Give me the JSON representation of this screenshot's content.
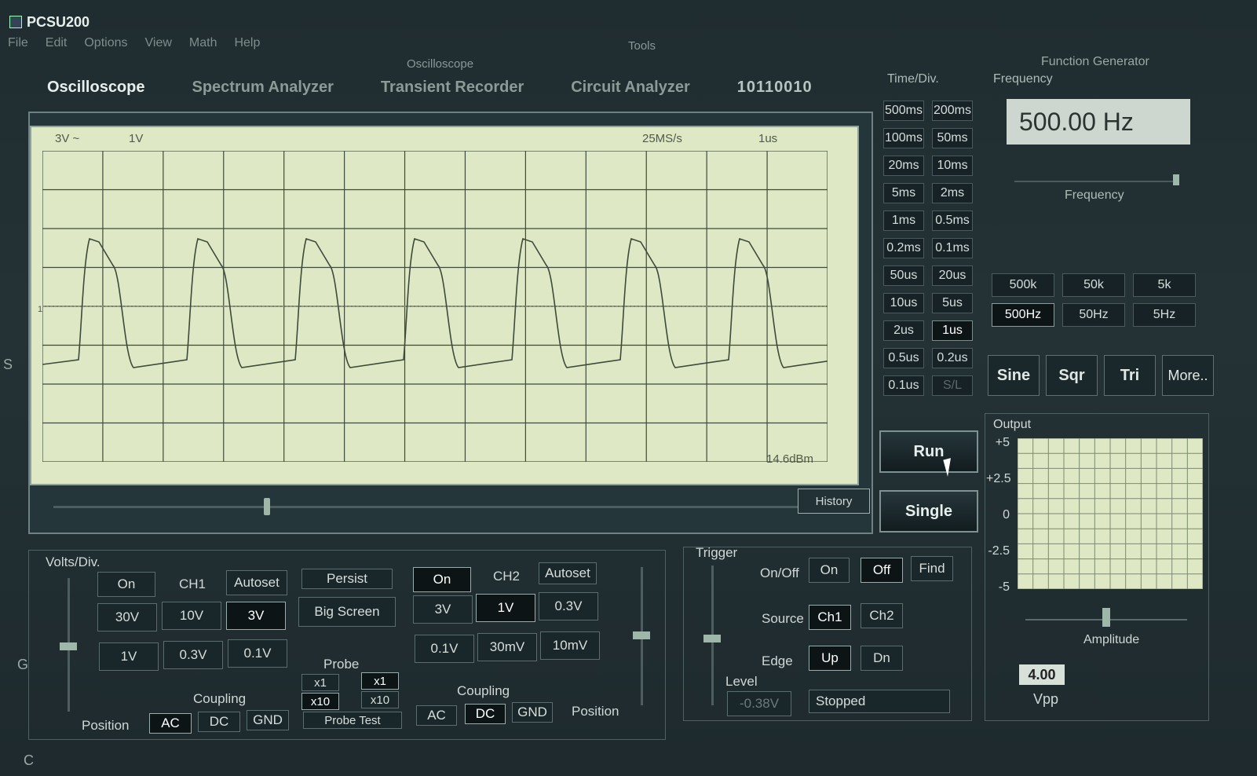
{
  "app": {
    "title": "PCSU200"
  },
  "menu": [
    "File",
    "Edit",
    "Options",
    "View",
    "Math",
    "Help"
  ],
  "labels": {
    "tools": "Tools",
    "oscilloscope_group": "Oscilloscope",
    "function_generator": "Function Generator"
  },
  "tabs": [
    {
      "label": "Oscilloscope",
      "active": true
    },
    {
      "label": "Spectrum Analyzer",
      "active": false
    },
    {
      "label": "Transient Recorder",
      "active": false
    },
    {
      "label": "Circuit Analyzer",
      "active": false
    }
  ],
  "binary_readout": "10110010",
  "screen": {
    "ch1_scale": "3V ~",
    "ch2_scale": "1V",
    "sample_rate": "25MS/s",
    "timebase": "1us",
    "power": "14.6dBm",
    "marker": "1"
  },
  "history_label": "History",
  "timediv": {
    "label": "Time/Div.",
    "buttons": [
      "500ms",
      "200ms",
      "100ms",
      "50ms",
      "20ms",
      "10ms",
      "5ms",
      "2ms",
      "1ms",
      "0.5ms",
      "0.2ms",
      "0.1ms",
      "50us",
      "20us",
      "10us",
      "5us",
      "2us",
      "1us",
      "0.5us",
      "0.2us",
      "0.1us",
      "S/L"
    ],
    "selected": "1us"
  },
  "run_label": "Run",
  "single_label": "Single",
  "fg": {
    "frequency_label": "Frequency",
    "frequency_value": "500.00 Hz",
    "frequency_slider_label": "Frequency",
    "ranges": [
      "500k",
      "50k",
      "5k",
      "500Hz",
      "50Hz",
      "5Hz"
    ],
    "selected_range": "500Hz",
    "waveforms": [
      "Sine",
      "Sqr",
      "Tri",
      "More.."
    ],
    "output_label": "Output",
    "output_ticks": [
      "+5",
      "+2.5",
      "0",
      "-2.5",
      "-5"
    ],
    "amplitude_label": "Amplitude",
    "amplitude_value": "4.00",
    "amplitude_unit": "Vpp"
  },
  "ch1": {
    "voltsdiv_label": "Volts/Div.",
    "label": "CH1",
    "on": "On",
    "autoset": "Autoset",
    "ranges": [
      "30V",
      "10V",
      "3V",
      "1V",
      "0.3V",
      "0.1V"
    ],
    "selected_range": "3V",
    "coupling_label": "Coupling",
    "coupling": [
      "AC",
      "DC",
      "GND"
    ],
    "selected_coupling": "AC",
    "position_label": "Position"
  },
  "middle": {
    "persist": "Persist",
    "big_screen": "Big Screen",
    "probe_label": "Probe",
    "probe_ch1": [
      "x1",
      "x10"
    ],
    "probe_ch2": [
      "x1",
      "x10"
    ],
    "probe_test": "Probe Test"
  },
  "ch2": {
    "label": "CH2",
    "on": "On",
    "autoset": "Autoset",
    "ranges": [
      "3V",
      "1V",
      "0.3V",
      "0.1V",
      "30mV",
      "10mV"
    ],
    "selected_range": "1V",
    "coupling_label": "Coupling",
    "coupling": [
      "AC",
      "DC",
      "GND"
    ],
    "selected_coupling": "DC",
    "position_label": "Position"
  },
  "trigger": {
    "label": "Trigger",
    "onoff_label": "On/Off",
    "on": "On",
    "off": "Off",
    "find": "Find",
    "source_label": "Source",
    "source": [
      "Ch1",
      "Ch2"
    ],
    "edge_label": "Edge",
    "edge": [
      "Up",
      "Dn"
    ],
    "level_label": "Level",
    "level_value": "-0.38V",
    "status": "Stopped"
  },
  "side_letters": [
    "S",
    "G",
    "C"
  ],
  "colors": {
    "screen_bg": "#dfe8c4",
    "trace": "#3e4a3c",
    "panel": "#1f2c30"
  }
}
